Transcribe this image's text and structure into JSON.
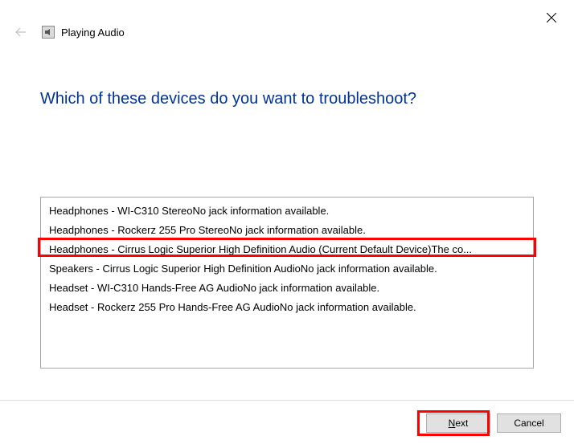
{
  "titlebar": {
    "close_label": "Close"
  },
  "header": {
    "back_label": "Back",
    "app_title": "Playing Audio"
  },
  "main": {
    "heading": "Which of these devices do you want to troubleshoot?",
    "devices": [
      "Headphones - WI-C310 StereoNo jack information available.",
      "Headphones - Rockerz 255 Pro StereoNo jack information available.",
      "Headphones - Cirrus Logic Superior High Definition Audio (Current Default Device)The co...",
      "Speakers - Cirrus Logic Superior High Definition AudioNo jack information available.",
      "Headset - WI-C310 Hands-Free AG AudioNo jack information available.",
      "Headset - Rockerz 255 Pro Hands-Free AG AudioNo jack information available."
    ]
  },
  "footer": {
    "next_prefix": "N",
    "next_rest": "ext",
    "cancel_label": "Cancel"
  }
}
